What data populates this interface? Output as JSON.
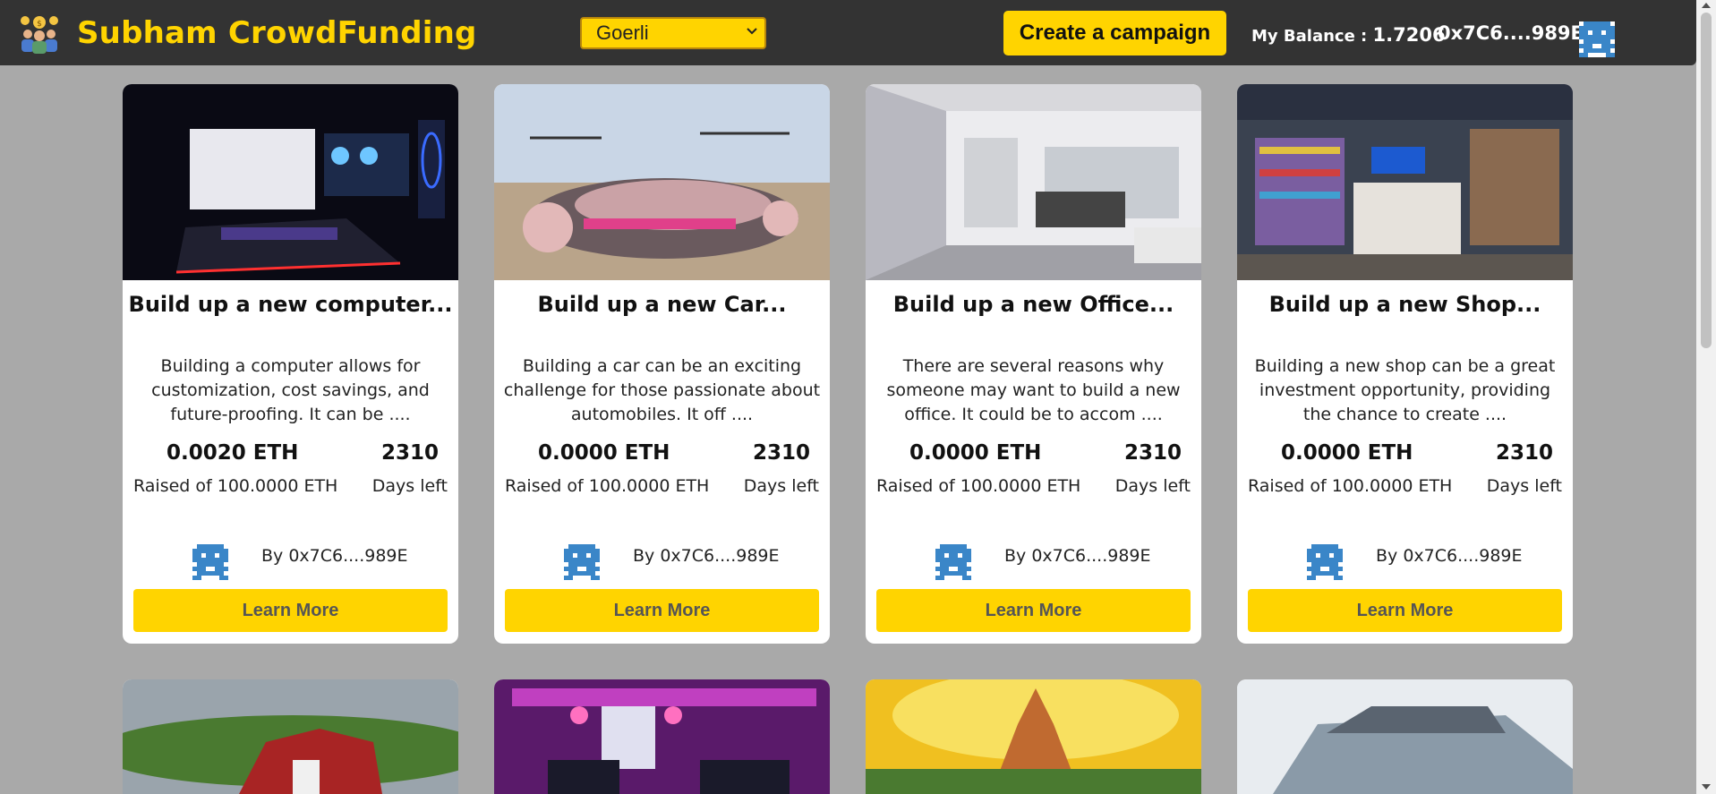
{
  "header": {
    "brand": "Subham CrowdFunding",
    "logo_icon": "crowd-people-icon",
    "network_selected": "Goerli",
    "create_label": "Create a campaign",
    "balance_label": "My Balance : ",
    "balance_value": "1.7206",
    "account": "0x7C6....989E",
    "avatar_icon": "pixel-avatar-icon"
  },
  "colors": {
    "accent": "#ffd400",
    "header_bg": "#333333",
    "page_bg": "#a9a9a9",
    "avatar_blue": "#3a86c8"
  },
  "campaigns": [
    {
      "title": "Build up a new computer...",
      "description": "Building a computer allows for customization, cost savings, and future-proofing. It can be ....",
      "amount": "0.0020 ETH",
      "days": "2310",
      "raised_label": "Raised of 100.0000 ETH",
      "days_label": "Days left",
      "owner": "By 0x7C6....989E",
      "button": "Learn More",
      "image": "gaming-computer-setup"
    },
    {
      "title": "Build up a new Car...",
      "description": "Building a car can be an exciting challenge for those passionate about automobiles. It off ....",
      "amount": "0.0000 ETH",
      "days": "2310",
      "raised_label": "Raised of 100.0000 ETH",
      "days_label": "Days left",
      "owner": "By 0x7C6....989E",
      "button": "Learn More",
      "image": "futuristic-flying-car"
    },
    {
      "title": "Build up a new Office...",
      "description": "There are several reasons why someone may want to build a new office. It could be to accom ....",
      "amount": "0.0000 ETH",
      "days": "2310",
      "raised_label": "Raised of 100.0000 ETH",
      "days_label": "Days left",
      "owner": "By 0x7C6....989E",
      "button": "Learn More",
      "image": "modern-office-interior"
    },
    {
      "title": "Build up a new Shop...",
      "description": "Building a new shop can be a great investment opportunity, providing the chance to create ....",
      "amount": "0.0000 ETH",
      "days": "2310",
      "raised_label": "Raised of 100.0000 ETH",
      "days_label": "Days left",
      "owner": "By 0x7C6....989E",
      "button": "Learn More",
      "image": "convenience-store-interior"
    }
  ],
  "campaigns_row2": [
    {
      "image": "red-barn-farm"
    },
    {
      "image": "neon-gaming-room"
    },
    {
      "image": "temple-sunset"
    },
    {
      "image": "grey-suv"
    }
  ]
}
